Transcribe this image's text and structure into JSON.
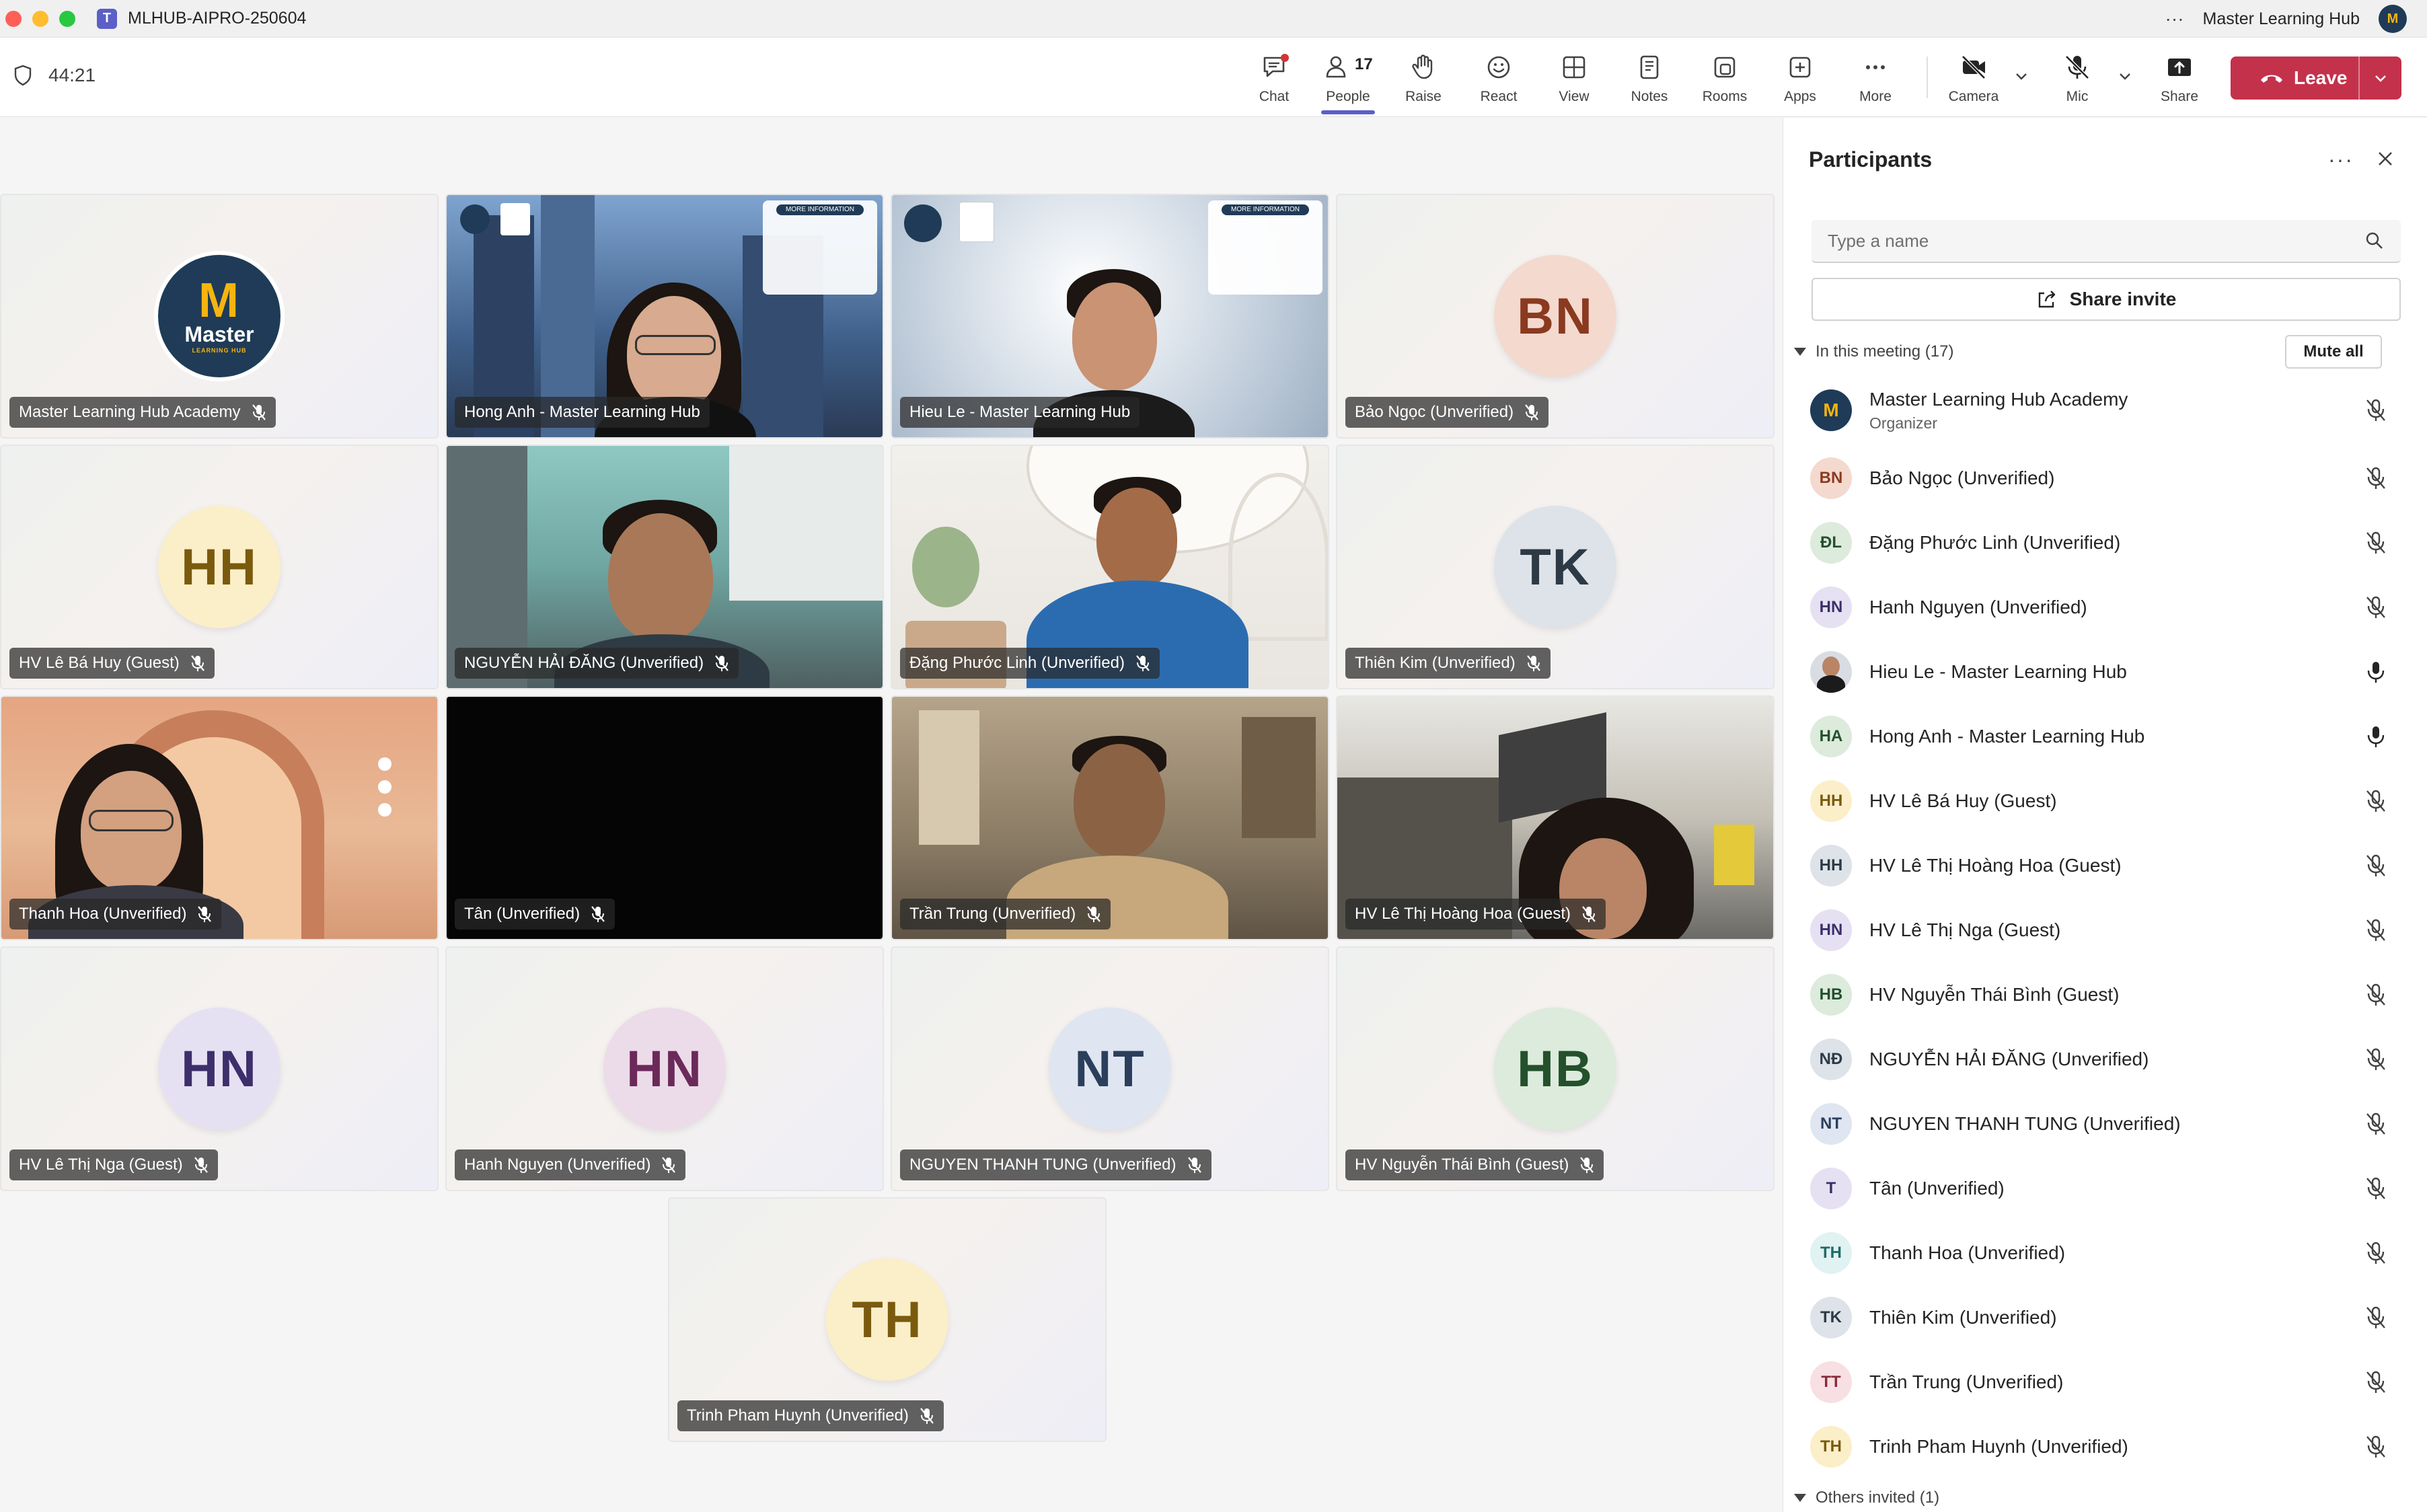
{
  "window": {
    "title": "MLHUB-AIPRO-250604",
    "account_name": "Master Learning Hub",
    "more_label": "···"
  },
  "meeting": {
    "timer": "44:21"
  },
  "toolbar": {
    "chat": "Chat",
    "people": "People",
    "people_count": "17",
    "raise": "Raise",
    "react": "React",
    "view": "View",
    "notes": "Notes",
    "rooms": "Rooms",
    "apps": "Apps",
    "more": "More",
    "camera": "Camera",
    "mic": "Mic",
    "share": "Share",
    "leave": "Leave"
  },
  "grid": {
    "tiles": [
      {
        "name": "Master Learning Hub Academy",
        "type": "logo",
        "logo_text": "Master",
        "logo_sub": "LEARNING HUB",
        "muted": true
      },
      {
        "name": "Hong Anh - Master Learning Hub",
        "type": "video",
        "muted": false
      },
      {
        "name": "Hieu Le - Master Learning Hub",
        "type": "video",
        "muted": false
      },
      {
        "name": "Bảo Ngọc (Unverified)",
        "type": "avatar",
        "initials": "BN",
        "muted": true
      },
      {
        "name": "HV Lê Bá Huy (Guest)",
        "type": "avatar",
        "initials": "HH",
        "muted": true
      },
      {
        "name": "NGUYỄN HẢI ĐĂNG (Unverified)",
        "type": "video",
        "muted": true
      },
      {
        "name": "Đặng Phước Linh (Unverified)",
        "type": "video",
        "muted": true
      },
      {
        "name": "Thiên Kim (Unverified)",
        "type": "avatar",
        "initials": "TK",
        "muted": true
      },
      {
        "name": "Thanh Hoa (Unverified)",
        "type": "video",
        "muted": true
      },
      {
        "name": "Tân (Unverified)",
        "type": "video",
        "muted": true
      },
      {
        "name": "Trần Trung (Unverified)",
        "type": "video",
        "muted": true
      },
      {
        "name": "HV Lê Thị Hoàng Hoa (Guest)",
        "type": "video",
        "muted": true
      },
      {
        "name": "HV Lê Thị Nga (Guest)",
        "type": "avatar",
        "initials": "HN",
        "muted": true
      },
      {
        "name": "Hanh Nguyen (Unverified)",
        "type": "avatar",
        "initials": "HN",
        "muted": true
      },
      {
        "name": "NGUYEN THANH TUNG (Unverified)",
        "type": "avatar",
        "initials": "NT",
        "muted": true
      },
      {
        "name": "HV Nguyễn Thái Bình (Guest)",
        "type": "avatar",
        "initials": "HB",
        "muted": true
      },
      {
        "name": "Trinh Pham Huynh (Unverified)",
        "type": "avatar",
        "initials": "TH",
        "muted": true
      }
    ],
    "banner": {
      "text": "MORE INFORMATION"
    }
  },
  "panel": {
    "title": "Participants",
    "search_placeholder": "Type a name",
    "share_invite": "Share invite",
    "section_in_meeting": "In this meeting (17)",
    "mute_all": "Mute all",
    "others_invited": "Others invited (1)",
    "participants": [
      {
        "name": "Master Learning Hub Academy",
        "role": "Organizer",
        "initials": "M",
        "muted": true,
        "avatar_kind": "logo"
      },
      {
        "name": "Bảo Ngọc (Unverified)",
        "initials": "BN",
        "muted": true
      },
      {
        "name": "Đặng Phước Linh (Unverified)",
        "initials": "ĐL",
        "muted": true
      },
      {
        "name": "Hanh Nguyen (Unverified)",
        "initials": "HN",
        "muted": true
      },
      {
        "name": "Hieu Le - Master Learning Hub",
        "initials": "",
        "muted": false,
        "avatar_kind": "photo"
      },
      {
        "name": "Hong Anh - Master Learning Hub",
        "initials": "HA",
        "muted": false
      },
      {
        "name": "HV Lê Bá Huy (Guest)",
        "initials": "HH",
        "muted": true
      },
      {
        "name": "HV Lê Thị Hoàng Hoa (Guest)",
        "initials": "HH",
        "muted": true
      },
      {
        "name": "HV Lê Thị Nga (Guest)",
        "initials": "HN",
        "muted": true
      },
      {
        "name": "HV Nguyễn Thái Bình (Guest)",
        "initials": "HB",
        "muted": true
      },
      {
        "name": "NGUYỄN HẢI ĐĂNG (Unverified)",
        "initials": "NĐ",
        "muted": true
      },
      {
        "name": "NGUYEN THANH TUNG (Unverified)",
        "initials": "NT",
        "muted": true
      },
      {
        "name": "Tân (Unverified)",
        "initials": "T",
        "muted": true
      },
      {
        "name": "Thanh Hoa (Unverified)",
        "initials": "TH",
        "muted": true
      },
      {
        "name": "Thiên Kim (Unverified)",
        "initials": "TK",
        "muted": true
      },
      {
        "name": "Trần Trung (Unverified)",
        "initials": "TT",
        "muted": true
      },
      {
        "name": "Trinh Pham Huynh (Unverified)",
        "initials": "TH",
        "muted": true
      }
    ]
  },
  "colors": {
    "accent": "#5b5fc7",
    "leave": "#c4314b",
    "initials_palette": {
      "BN": [
        "#f4d9cf",
        "#8a3a1f"
      ],
      "HH": [
        "#fbefc9",
        "#7a5a0e"
      ],
      "TK": [
        "#dde3e8",
        "#2d3a46"
      ],
      "HN": [
        "#e6e1f2",
        "#3d2f6b"
      ],
      "HN2": [
        "#ecdbe8",
        "#6b2a5a"
      ],
      "NT": [
        "#dfe6f1",
        "#2b3f5c"
      ],
      "HB": [
        "#dcebdc",
        "#24502c"
      ],
      "TH": [
        "#fbefc9",
        "#7a5a0e"
      ]
    }
  }
}
